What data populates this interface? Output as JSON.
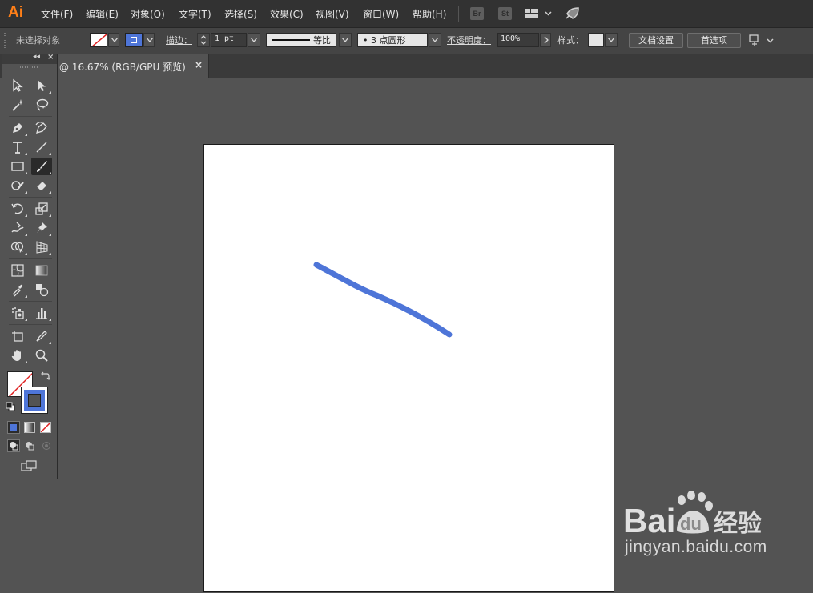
{
  "app": {
    "logo": "Ai"
  },
  "menubar": {
    "items": [
      {
        "label": "文件(F)"
      },
      {
        "label": "编辑(E)"
      },
      {
        "label": "对象(O)"
      },
      {
        "label": "文字(T)"
      },
      {
        "label": "选择(S)"
      },
      {
        "label": "效果(C)"
      },
      {
        "label": "视图(V)"
      },
      {
        "label": "窗口(W)"
      },
      {
        "label": "帮助(H)"
      }
    ],
    "bridge_badge": "Br",
    "stock_badge": "St",
    "icons": [
      "workspace-layout-icon",
      "rocket-icon"
    ]
  },
  "controlbar": {
    "selection_status": "未选择对象",
    "stroke_label": "描边：",
    "stroke_weight": "1 pt",
    "stroke_profile": "等比",
    "brush_definition": "• 3 点圆形",
    "opacity_label": "不透明度：",
    "opacity_value": "100%",
    "style_label": "样式：",
    "doc_setup_button": "文档设置",
    "preferences_button": "首选项",
    "fill_color": "none",
    "stroke_color": "#4e75d8"
  },
  "tabbar": {
    "doc_title": "@ 16.67% (RGB/GPU 预览)",
    "close_glyph": "×"
  },
  "tools": {
    "active_tool": "paintbrush-tool",
    "list": [
      "selection-tool",
      "direct-selection-tool",
      "magic-wand-tool",
      "lasso-tool",
      "pen-tool",
      "curvature-tool",
      "type-tool",
      "line-segment-tool",
      "rectangle-tool",
      "paintbrush-tool",
      "shaper-tool",
      "eraser-tool",
      "rotate-tool",
      "scale-tool",
      "warp-tool",
      "puppet-warp-tool",
      "shape-builder-tool",
      "perspective-grid-tool",
      "mesh-tool",
      "gradient-tool",
      "eyedropper-tool",
      "blend-tool",
      "symbol-sprayer-tool",
      "column-graph-tool",
      "artboard-tool",
      "slice-tool",
      "hand-tool",
      "zoom-tool"
    ]
  },
  "canvas": {
    "stroke_color": "#4e75d8"
  },
  "watermark": {
    "brand_text": "Bai",
    "brand_du": "du",
    "brand_cn": "经验",
    "url": "jingyan.baidu.com"
  }
}
